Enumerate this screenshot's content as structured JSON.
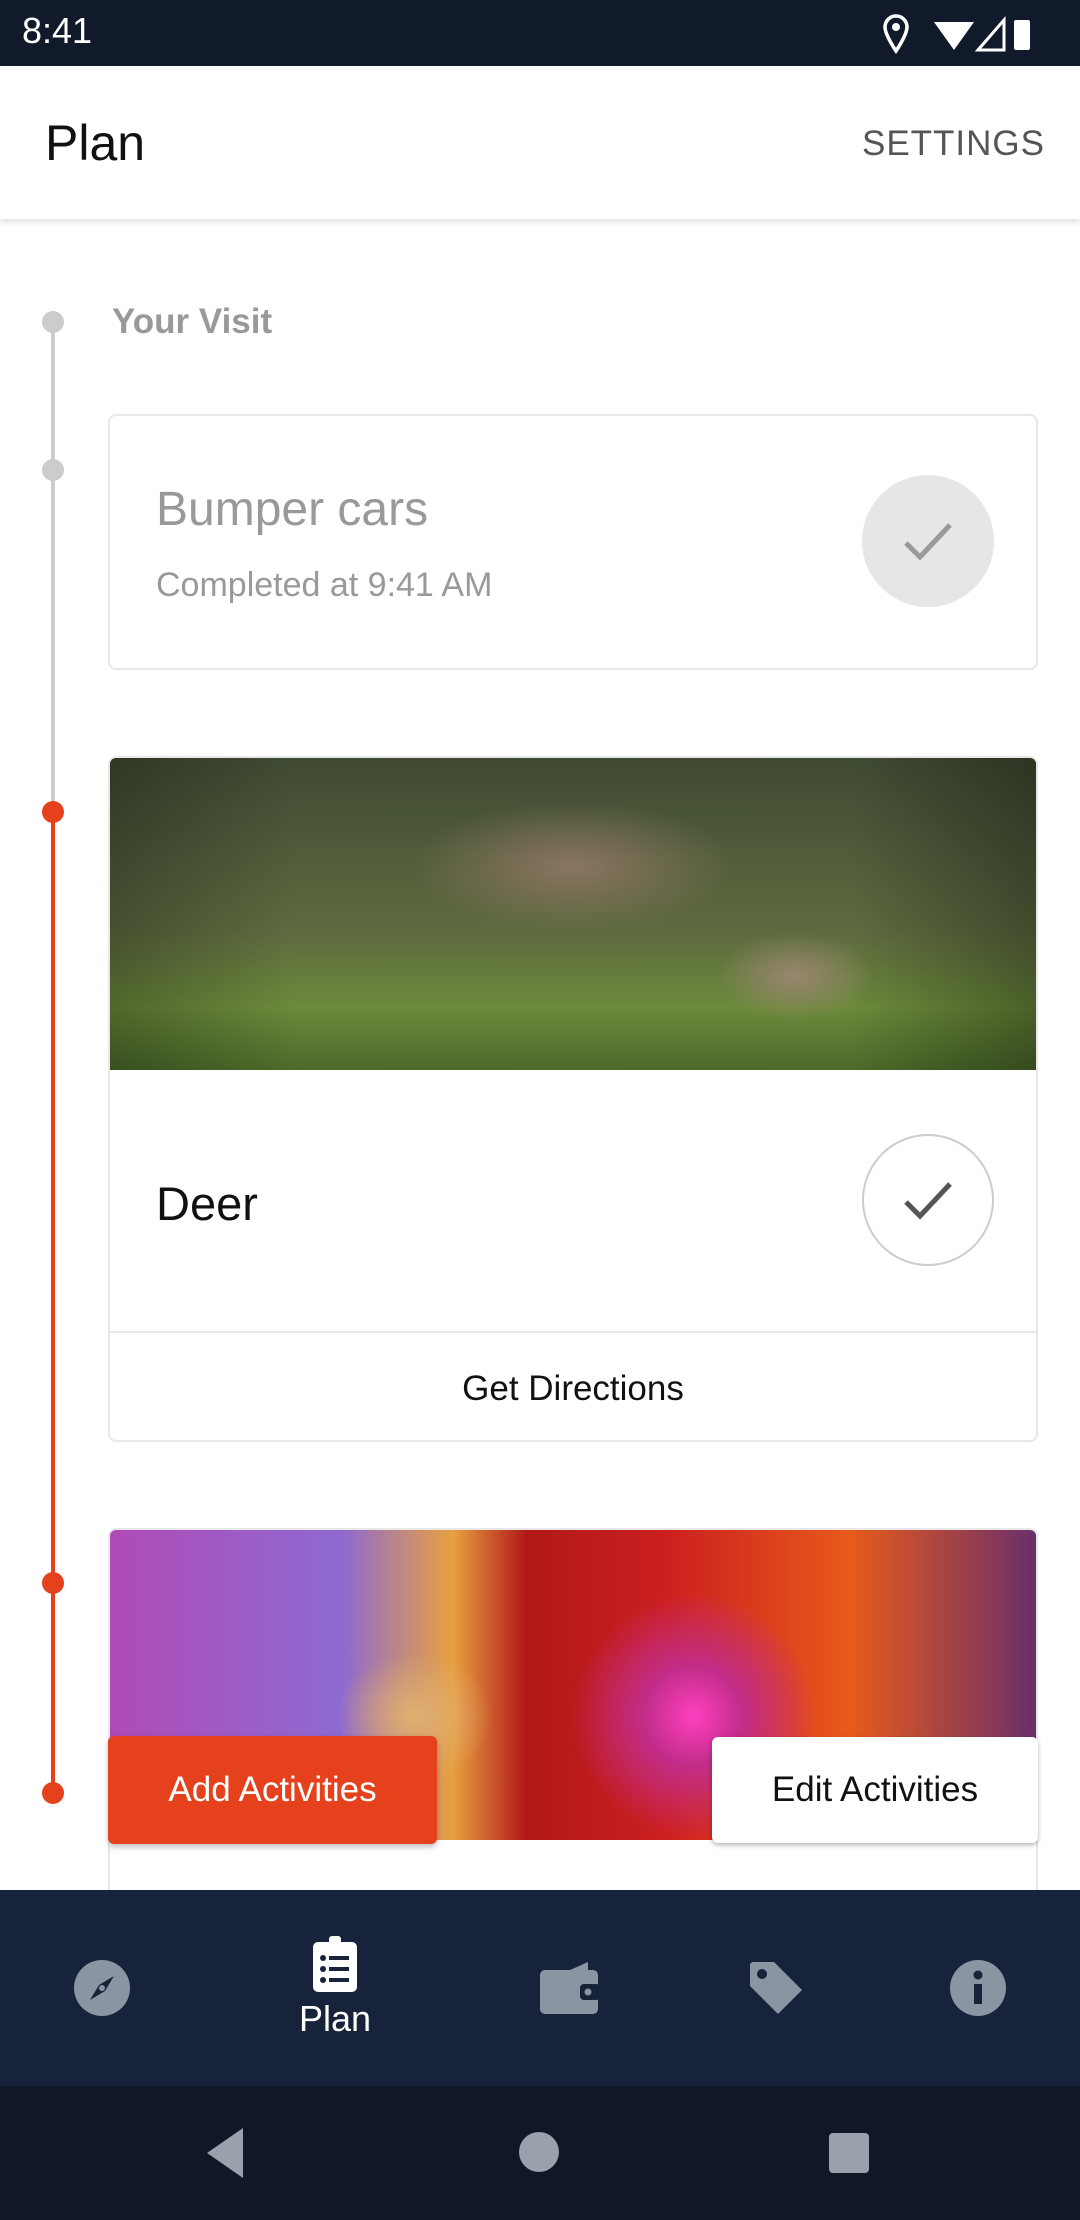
{
  "status_bar": {
    "time": "8:41"
  },
  "app_bar": {
    "title": "Plan",
    "settings_label": "SETTINGS"
  },
  "timeline": {
    "heading": "Your Visit",
    "colors": {
      "past": "#cccccc",
      "active": "#e5411c"
    },
    "items": [
      {
        "title": "Bumper cars",
        "subtitle": "Completed at 9:41 AM",
        "state": "completed"
      },
      {
        "title": "Deer",
        "action": "Get Directions",
        "state": "pending"
      }
    ]
  },
  "actions": {
    "add_label": "Add Activities",
    "edit_label": "Edit Activities",
    "accent": "#e5411c"
  },
  "bottom_nav": {
    "items": [
      {
        "icon": "compass-icon",
        "label": ""
      },
      {
        "icon": "clipboard-list-icon",
        "label": "Plan",
        "active": true
      },
      {
        "icon": "wallet-icon",
        "label": ""
      },
      {
        "icon": "tag-icon",
        "label": ""
      },
      {
        "icon": "info-icon",
        "label": ""
      }
    ]
  }
}
